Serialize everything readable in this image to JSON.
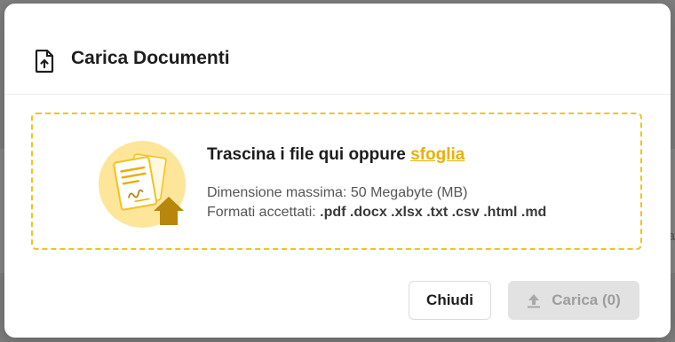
{
  "modal": {
    "title": "Carica Documenti",
    "title_icon": "upload-file-icon"
  },
  "dropzone": {
    "prompt_text": "Trascina i file qui oppure ",
    "browse_link": "sfoglia",
    "max_size_label": "Dimensione massima: 50 Megabyte (MB)",
    "formats_label": "Formati accettati: ",
    "formats_values": ".pdf .docx .xlsx .txt .csv .html .md",
    "illustration_icon": "document-upload-illustration"
  },
  "footer": {
    "close_label": "Chiudi",
    "upload_label": "Carica (0)",
    "upload_icon": "upload-arrow-icon"
  },
  "background": {
    "partial_text": "a"
  },
  "colors": {
    "accent": "#f3c21b",
    "link": "#e8b003",
    "illustration_bg": "#fde59a",
    "arrow": "#b8860b",
    "disabled_bg": "#e2e2e2",
    "disabled_text": "#9d9d9d"
  }
}
